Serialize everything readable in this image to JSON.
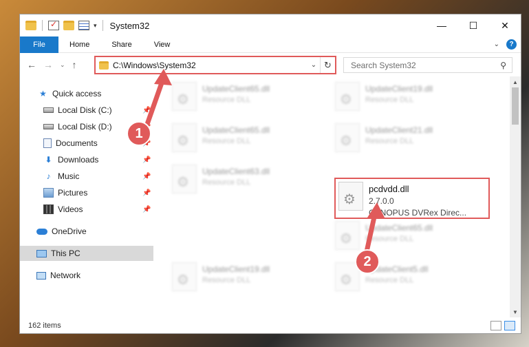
{
  "window": {
    "title": "System32",
    "controls": {
      "minimize": "—",
      "maximize": "☐",
      "close": "✕"
    }
  },
  "ribbon": {
    "tabs": [
      "File",
      "Home",
      "Share",
      "View"
    ],
    "help": "?"
  },
  "address_bar": {
    "path": "C:\\Windows\\System32",
    "dropdown": "⌄",
    "refresh": "↻"
  },
  "search": {
    "placeholder": "Search System32",
    "icon": "search-icon"
  },
  "sidebar": {
    "items": [
      {
        "label": "Quick access",
        "icon": "star-icon",
        "pinned": false
      },
      {
        "label": "Local Disk (C:)",
        "icon": "disk-icon",
        "pinned": true
      },
      {
        "label": "Local Disk (D:)",
        "icon": "disk-icon",
        "pinned": true
      },
      {
        "label": "Documents",
        "icon": "documents-icon",
        "pinned": true
      },
      {
        "label": "Downloads",
        "icon": "download-icon",
        "pinned": true
      },
      {
        "label": "Music",
        "icon": "music-icon",
        "pinned": true
      },
      {
        "label": "Pictures",
        "icon": "pictures-icon",
        "pinned": true
      },
      {
        "label": "Videos",
        "icon": "videos-icon",
        "pinned": true
      },
      {
        "label": "OneDrive",
        "icon": "cloud-icon",
        "pinned": false
      },
      {
        "label": "This PC",
        "icon": "computer-icon",
        "pinned": false,
        "selected": true
      },
      {
        "label": "Network",
        "icon": "network-icon",
        "pinned": false
      }
    ]
  },
  "files": [
    {
      "name": "UpdateClient65.dll",
      "sub": "Resource DLL",
      "blurred": true
    },
    {
      "name": "UpdateClient19.dll",
      "sub": "Resource DLL",
      "blurred": true
    },
    {
      "name": "UpdateClient65.dll",
      "sub": "Resource DLL",
      "blurred": true
    },
    {
      "name": "UpdateClient21.dll",
      "sub": "Resource DLL",
      "blurred": true
    },
    {
      "name": "UpdateClient63.dll",
      "sub": "Resource DLL",
      "blurred": true
    },
    {
      "name": "pcdvdd.dll",
      "sub": "2.7.0.0",
      "type": "CANOPUS DVRex Direc...",
      "highlighted": true
    },
    {
      "name": "UpdateClient65.dll",
      "sub": "Resource DLL",
      "blurred": true
    },
    {
      "name": "UpdateClient19.dll",
      "sub": "Resource DLL",
      "blurred": true
    },
    {
      "name": "UpdateClient5.dll",
      "sub": "Resource DLL",
      "blurred": true
    }
  ],
  "status": {
    "item_count": "162 items"
  },
  "annotations": {
    "step1": "1",
    "step2": "2",
    "color": "#e05a5a"
  }
}
